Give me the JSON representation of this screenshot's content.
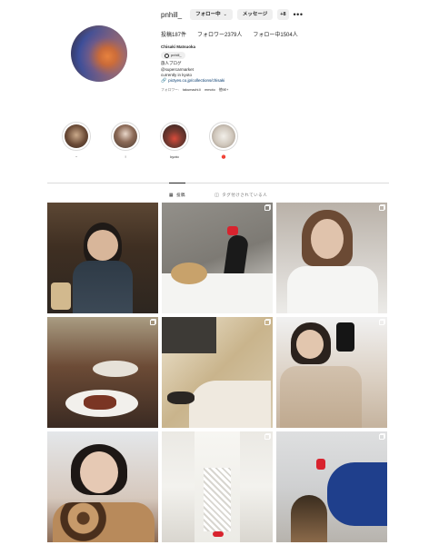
{
  "profile": {
    "username": "pnhill_",
    "follow_button": "フォロー中",
    "message_button": "メッセージ",
    "add_user_icon": "+8",
    "more_icon": "•••",
    "stats": {
      "posts": "投稿187件",
      "followers": "フォロワー2379人",
      "following": "フォロー中1504人"
    },
    "bio": {
      "name": "Chisaki Matsuoka",
      "threads": "pnhill_",
      "line1": "旅人ブログ",
      "line2": "@supercarmarket",
      "line3": "currently in kyoto",
      "link": "pictyes.co.jp/collections/chisaki",
      "followed_by_prefix": "フォロワー:",
      "followed_by": [
        "takumachi.li",
        "mmoto",
        "他9E+"
      ]
    }
  },
  "highlights": [
    {
      "label": "~",
      "red": false
    },
    {
      "label": "!",
      "red": false
    },
    {
      "label": "kyoto",
      "red": false
    },
    {
      "label": "🔴",
      "red": true
    }
  ],
  "tabs": [
    {
      "label": "投稿",
      "icon": "grid-icon",
      "active": true
    },
    {
      "label": "タグ付けされている人",
      "icon": "tag-icon",
      "active": false
    }
  ],
  "posts": [
    {
      "id": "post-1",
      "multi": false
    },
    {
      "id": "post-2",
      "multi": true
    },
    {
      "id": "post-3",
      "multi": true
    },
    {
      "id": "post-4",
      "multi": true
    },
    {
      "id": "post-5",
      "multi": true
    },
    {
      "id": "post-6",
      "multi": true
    },
    {
      "id": "post-7",
      "multi": false
    },
    {
      "id": "post-8",
      "multi": true
    },
    {
      "id": "post-9",
      "multi": true
    }
  ]
}
